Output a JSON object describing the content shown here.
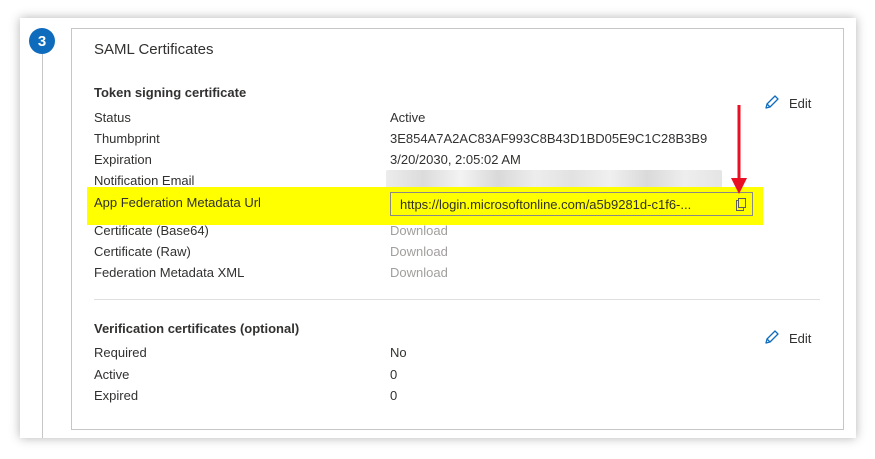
{
  "step": {
    "number": "3"
  },
  "card": {
    "title": "SAML Certificates"
  },
  "token_signing": {
    "title": "Token signing certificate",
    "edit_label": "Edit",
    "rows": [
      {
        "label": "Status",
        "value": "Active"
      },
      {
        "label": "Thumbprint",
        "value": "3E854A7A2AC83AF993C8B43D1BD05E9C1C28B3B9"
      },
      {
        "label": "Expiration",
        "value": "3/20/2030, 2:05:02 AM"
      },
      {
        "label": "Notification Email",
        "value": ""
      },
      {
        "label": "App Federation Metadata Url",
        "value": "https://login.microsoftonline.com/a5b9281d-c1f6-..."
      },
      {
        "label": "Certificate (Base64)",
        "value": "Download"
      },
      {
        "label": "Certificate (Raw)",
        "value": "Download"
      },
      {
        "label": "Federation Metadata XML",
        "value": "Download"
      }
    ]
  },
  "verification": {
    "title": "Verification certificates (optional)",
    "edit_label": "Edit",
    "rows": [
      {
        "label": "Required",
        "value": "No"
      },
      {
        "label": "Active",
        "value": "0"
      },
      {
        "label": "Expired",
        "value": "0"
      }
    ]
  },
  "colors": {
    "accent": "#0f6cbd",
    "highlight": "#ffff00",
    "annotation_arrow": "#e81123",
    "muted_link": "#a19f9d"
  },
  "icons": {
    "edit": "pencil-icon",
    "copy": "copy-icon",
    "annotation": "red-down-arrow"
  }
}
